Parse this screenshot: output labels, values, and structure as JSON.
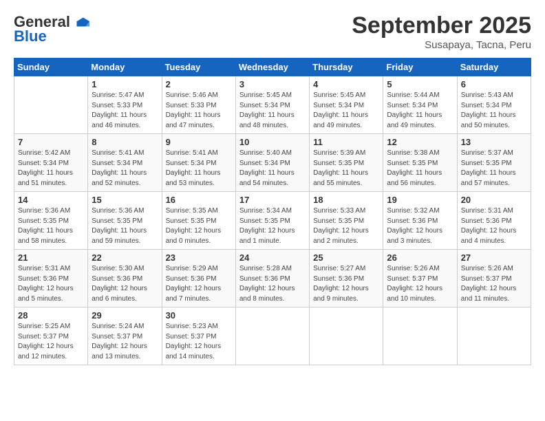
{
  "logo": {
    "general": "General",
    "blue": "Blue"
  },
  "title": "September 2025",
  "location": "Susapaya, Tacna, Peru",
  "weekdays": [
    "Sunday",
    "Monday",
    "Tuesday",
    "Wednesday",
    "Thursday",
    "Friday",
    "Saturday"
  ],
  "weeks": [
    [
      {
        "day": null,
        "info": ""
      },
      {
        "day": "1",
        "info": "Sunrise: 5:47 AM\nSunset: 5:33 PM\nDaylight: 11 hours\nand 46 minutes."
      },
      {
        "day": "2",
        "info": "Sunrise: 5:46 AM\nSunset: 5:33 PM\nDaylight: 11 hours\nand 47 minutes."
      },
      {
        "day": "3",
        "info": "Sunrise: 5:45 AM\nSunset: 5:34 PM\nDaylight: 11 hours\nand 48 minutes."
      },
      {
        "day": "4",
        "info": "Sunrise: 5:45 AM\nSunset: 5:34 PM\nDaylight: 11 hours\nand 49 minutes."
      },
      {
        "day": "5",
        "info": "Sunrise: 5:44 AM\nSunset: 5:34 PM\nDaylight: 11 hours\nand 49 minutes."
      },
      {
        "day": "6",
        "info": "Sunrise: 5:43 AM\nSunset: 5:34 PM\nDaylight: 11 hours\nand 50 minutes."
      }
    ],
    [
      {
        "day": "7",
        "info": "Sunrise: 5:42 AM\nSunset: 5:34 PM\nDaylight: 11 hours\nand 51 minutes."
      },
      {
        "day": "8",
        "info": "Sunrise: 5:41 AM\nSunset: 5:34 PM\nDaylight: 11 hours\nand 52 minutes."
      },
      {
        "day": "9",
        "info": "Sunrise: 5:41 AM\nSunset: 5:34 PM\nDaylight: 11 hours\nand 53 minutes."
      },
      {
        "day": "10",
        "info": "Sunrise: 5:40 AM\nSunset: 5:34 PM\nDaylight: 11 hours\nand 54 minutes."
      },
      {
        "day": "11",
        "info": "Sunrise: 5:39 AM\nSunset: 5:35 PM\nDaylight: 11 hours\nand 55 minutes."
      },
      {
        "day": "12",
        "info": "Sunrise: 5:38 AM\nSunset: 5:35 PM\nDaylight: 11 hours\nand 56 minutes."
      },
      {
        "day": "13",
        "info": "Sunrise: 5:37 AM\nSunset: 5:35 PM\nDaylight: 11 hours\nand 57 minutes."
      }
    ],
    [
      {
        "day": "14",
        "info": "Sunrise: 5:36 AM\nSunset: 5:35 PM\nDaylight: 11 hours\nand 58 minutes."
      },
      {
        "day": "15",
        "info": "Sunrise: 5:36 AM\nSunset: 5:35 PM\nDaylight: 11 hours\nand 59 minutes."
      },
      {
        "day": "16",
        "info": "Sunrise: 5:35 AM\nSunset: 5:35 PM\nDaylight: 12 hours\nand 0 minutes."
      },
      {
        "day": "17",
        "info": "Sunrise: 5:34 AM\nSunset: 5:35 PM\nDaylight: 12 hours\nand 1 minute."
      },
      {
        "day": "18",
        "info": "Sunrise: 5:33 AM\nSunset: 5:35 PM\nDaylight: 12 hours\nand 2 minutes."
      },
      {
        "day": "19",
        "info": "Sunrise: 5:32 AM\nSunset: 5:36 PM\nDaylight: 12 hours\nand 3 minutes."
      },
      {
        "day": "20",
        "info": "Sunrise: 5:31 AM\nSunset: 5:36 PM\nDaylight: 12 hours\nand 4 minutes."
      }
    ],
    [
      {
        "day": "21",
        "info": "Sunrise: 5:31 AM\nSunset: 5:36 PM\nDaylight: 12 hours\nand 5 minutes."
      },
      {
        "day": "22",
        "info": "Sunrise: 5:30 AM\nSunset: 5:36 PM\nDaylight: 12 hours\nand 6 minutes."
      },
      {
        "day": "23",
        "info": "Sunrise: 5:29 AM\nSunset: 5:36 PM\nDaylight: 12 hours\nand 7 minutes."
      },
      {
        "day": "24",
        "info": "Sunrise: 5:28 AM\nSunset: 5:36 PM\nDaylight: 12 hours\nand 8 minutes."
      },
      {
        "day": "25",
        "info": "Sunrise: 5:27 AM\nSunset: 5:36 PM\nDaylight: 12 hours\nand 9 minutes."
      },
      {
        "day": "26",
        "info": "Sunrise: 5:26 AM\nSunset: 5:37 PM\nDaylight: 12 hours\nand 10 minutes."
      },
      {
        "day": "27",
        "info": "Sunrise: 5:26 AM\nSunset: 5:37 PM\nDaylight: 12 hours\nand 11 minutes."
      }
    ],
    [
      {
        "day": "28",
        "info": "Sunrise: 5:25 AM\nSunset: 5:37 PM\nDaylight: 12 hours\nand 12 minutes."
      },
      {
        "day": "29",
        "info": "Sunrise: 5:24 AM\nSunset: 5:37 PM\nDaylight: 12 hours\nand 13 minutes."
      },
      {
        "day": "30",
        "info": "Sunrise: 5:23 AM\nSunset: 5:37 PM\nDaylight: 12 hours\nand 14 minutes."
      },
      {
        "day": null,
        "info": ""
      },
      {
        "day": null,
        "info": ""
      },
      {
        "day": null,
        "info": ""
      },
      {
        "day": null,
        "info": ""
      }
    ]
  ]
}
